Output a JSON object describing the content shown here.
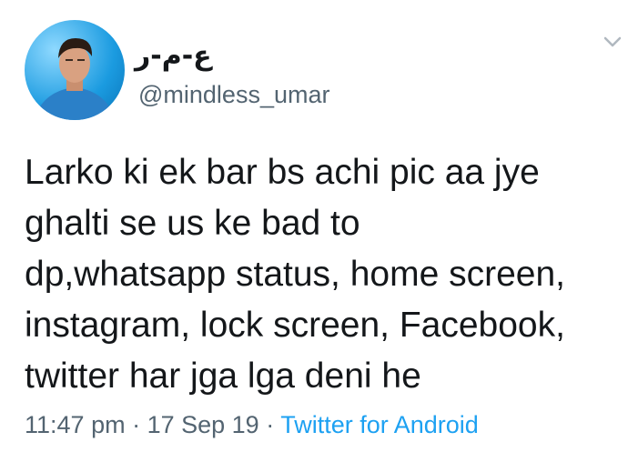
{
  "tweet": {
    "display_name": "ع-م-ر",
    "handle": "@mindless_umar",
    "text": "Larko ki ek bar bs achi pic aa jye\nghalti se us ke bad to\ndp,whatsapp status, home screen,\ninstagram, lock screen, Facebook,\ntwitter har jga lga deni he",
    "time": "11:47 pm",
    "separator1": " · ",
    "date": "17 Sep 19",
    "separator2": " · ",
    "source": "Twitter for Android"
  },
  "icons": {
    "avatar": "profile-photo",
    "menu": "chevron-down-icon"
  },
  "colors": {
    "text": "#14171a",
    "secondary": "#536471",
    "link": "#1da1f2"
  }
}
